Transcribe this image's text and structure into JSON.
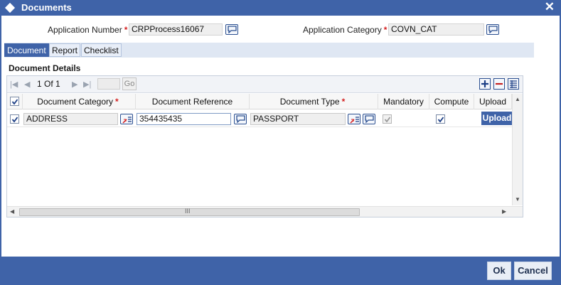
{
  "window": {
    "title": "Documents",
    "close_glyph": "✕"
  },
  "form": {
    "app_number_label": "Application Number",
    "app_number_value": "CRPProcess16067",
    "app_category_label": "Application Category",
    "app_category_value": "COVN_CAT",
    "required_marker": "*"
  },
  "tabs": [
    {
      "label": "Document",
      "active": true
    },
    {
      "label": "Report",
      "active": false
    },
    {
      "label": "Checklist",
      "active": false
    }
  ],
  "section": {
    "title": "Document Details"
  },
  "pagination": {
    "text": "1 Of 1",
    "go_label": "Go"
  },
  "grid": {
    "columns": [
      "Document Category",
      "Document Reference",
      "Document Type",
      "Mandatory",
      "Compute",
      "Upload"
    ],
    "rows": [
      {
        "category": "ADDRESS",
        "reference": "354435435",
        "type": "PASSPORT",
        "mandatory": true,
        "compute": true,
        "upload_label": "Upload"
      }
    ],
    "scroll_grip": "III"
  },
  "footer": {
    "ok_label": "Ok",
    "cancel_label": "Cancel"
  },
  "colors": {
    "accent": "#3f63a8",
    "required": "#d42020"
  }
}
